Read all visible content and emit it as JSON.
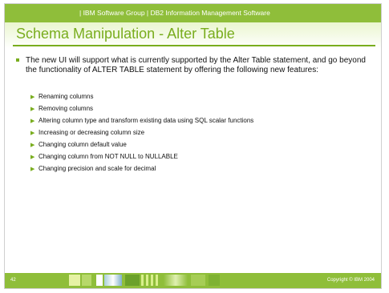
{
  "header": {
    "text": "| IBM Software Group  |  DB2 Information Management Software"
  },
  "title": "Schema Manipulation - Alter Table",
  "intro": "The new UI will support what is currently supported by the Alter Table statement, and go beyond the functionality of ALTER TABLE statement by offering the following new features:",
  "features": [
    "Renaming columns",
    "Removing columns",
    "Altering column type and transform existing data using SQL scalar functions",
    "Increasing or decreasing column size",
    "Changing column default value",
    "Changing column from NOT NULL to NULLABLE",
    "Changing precision and scale for decimal"
  ],
  "footer": {
    "page_number": "42",
    "copyright": "Copyright © IBM 2004"
  },
  "colors": {
    "accent": "#8fbe3a",
    "title": "#79ad1e"
  },
  "icons": {
    "bullet": "square-bullet-icon",
    "sub_bullet": "triangle-bullet-icon"
  }
}
